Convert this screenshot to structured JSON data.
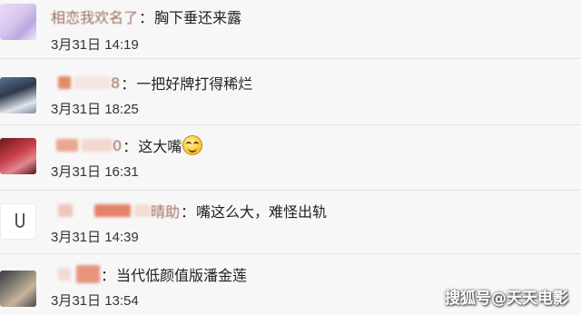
{
  "comments": [
    {
      "name_visible": "相恋我欢名了",
      "text": "胸下垂还来露",
      "time": "3月31日 14:19",
      "avatar": "avatar-cartoon-bunny"
    },
    {
      "name_visible": "8",
      "text": "一把好牌打得稀烂",
      "time": "3月31日 18:25",
      "avatar": "avatar-photo"
    },
    {
      "name_visible": "0",
      "text": "这大嘴",
      "time": "3月31日 16:31",
      "avatar": "avatar-red-photo",
      "emoji": "grin-emoji-icon"
    },
    {
      "name_visible": "晴助",
      "text": "嘴这么大，难怪出轨",
      "time": "3月31日 14:39",
      "avatar": "avatar-white"
    },
    {
      "name_visible": "",
      "text": "当代低颜值版潘金莲",
      "time": "3月31日 13:54",
      "avatar": "avatar-portrait"
    }
  ],
  "punct": {
    "colon": "："
  },
  "watermark": "搜狐号@天天电影"
}
